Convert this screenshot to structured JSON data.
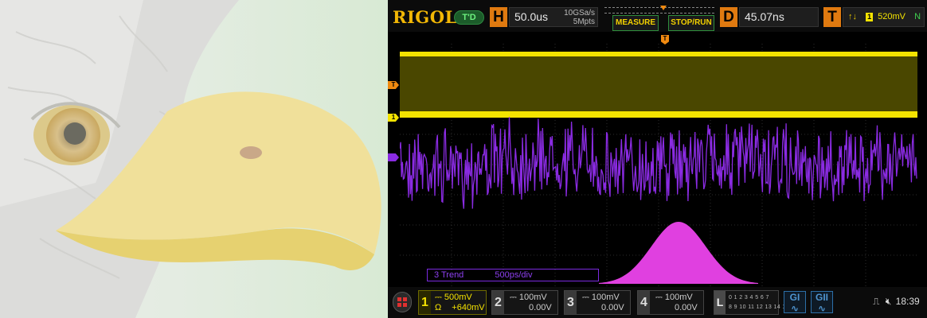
{
  "scope": {
    "brand": "RIGOL",
    "mode_badge": "T'D",
    "horizontal": {
      "letter": "H",
      "timebase": "50.0us",
      "sample_rate": "10GSa/s",
      "memory_depth": "5Mpts"
    },
    "measure_label": "MEASURE",
    "stop_run_label": "STOP/RUN",
    "delay": {
      "letter": "D",
      "value": "45.07ns"
    },
    "trigger": {
      "letter": "T",
      "slope": "↑↓",
      "source": "1",
      "level": "520mV",
      "mode": "N"
    },
    "trend_panel": {
      "name": "3 Trend",
      "scale": "500ps/div"
    },
    "markers": {
      "trigger": "T",
      "channel1": "1"
    },
    "channels": [
      {
        "num": "1",
        "scale": "500mV",
        "coupling": "Ω",
        "offset": "+640mV",
        "color": "#f4e300"
      },
      {
        "num": "2",
        "scale": "100mV",
        "offset": "0.00V",
        "color": "#9a9a9a"
      },
      {
        "num": "3",
        "scale": "100mV",
        "offset": "0.00V",
        "color": "#9a9a9a"
      },
      {
        "num": "4",
        "scale": "100mV",
        "offset": "0.00V",
        "color": "#9a9a9a"
      }
    ],
    "la": {
      "letter": "L",
      "bits_row1": "0 1 2 3 4 5 6 7",
      "bits_row2": "8 9 10 11 12 13 14 15"
    },
    "generators": [
      {
        "label": "GI"
      },
      {
        "label": "GII"
      }
    ],
    "clock": "18:39",
    "colors": {
      "ch1": "#f4e300",
      "trend": "#8a2be2",
      "histogram": "#e040e0",
      "trigger": "#f08a10"
    }
  }
}
